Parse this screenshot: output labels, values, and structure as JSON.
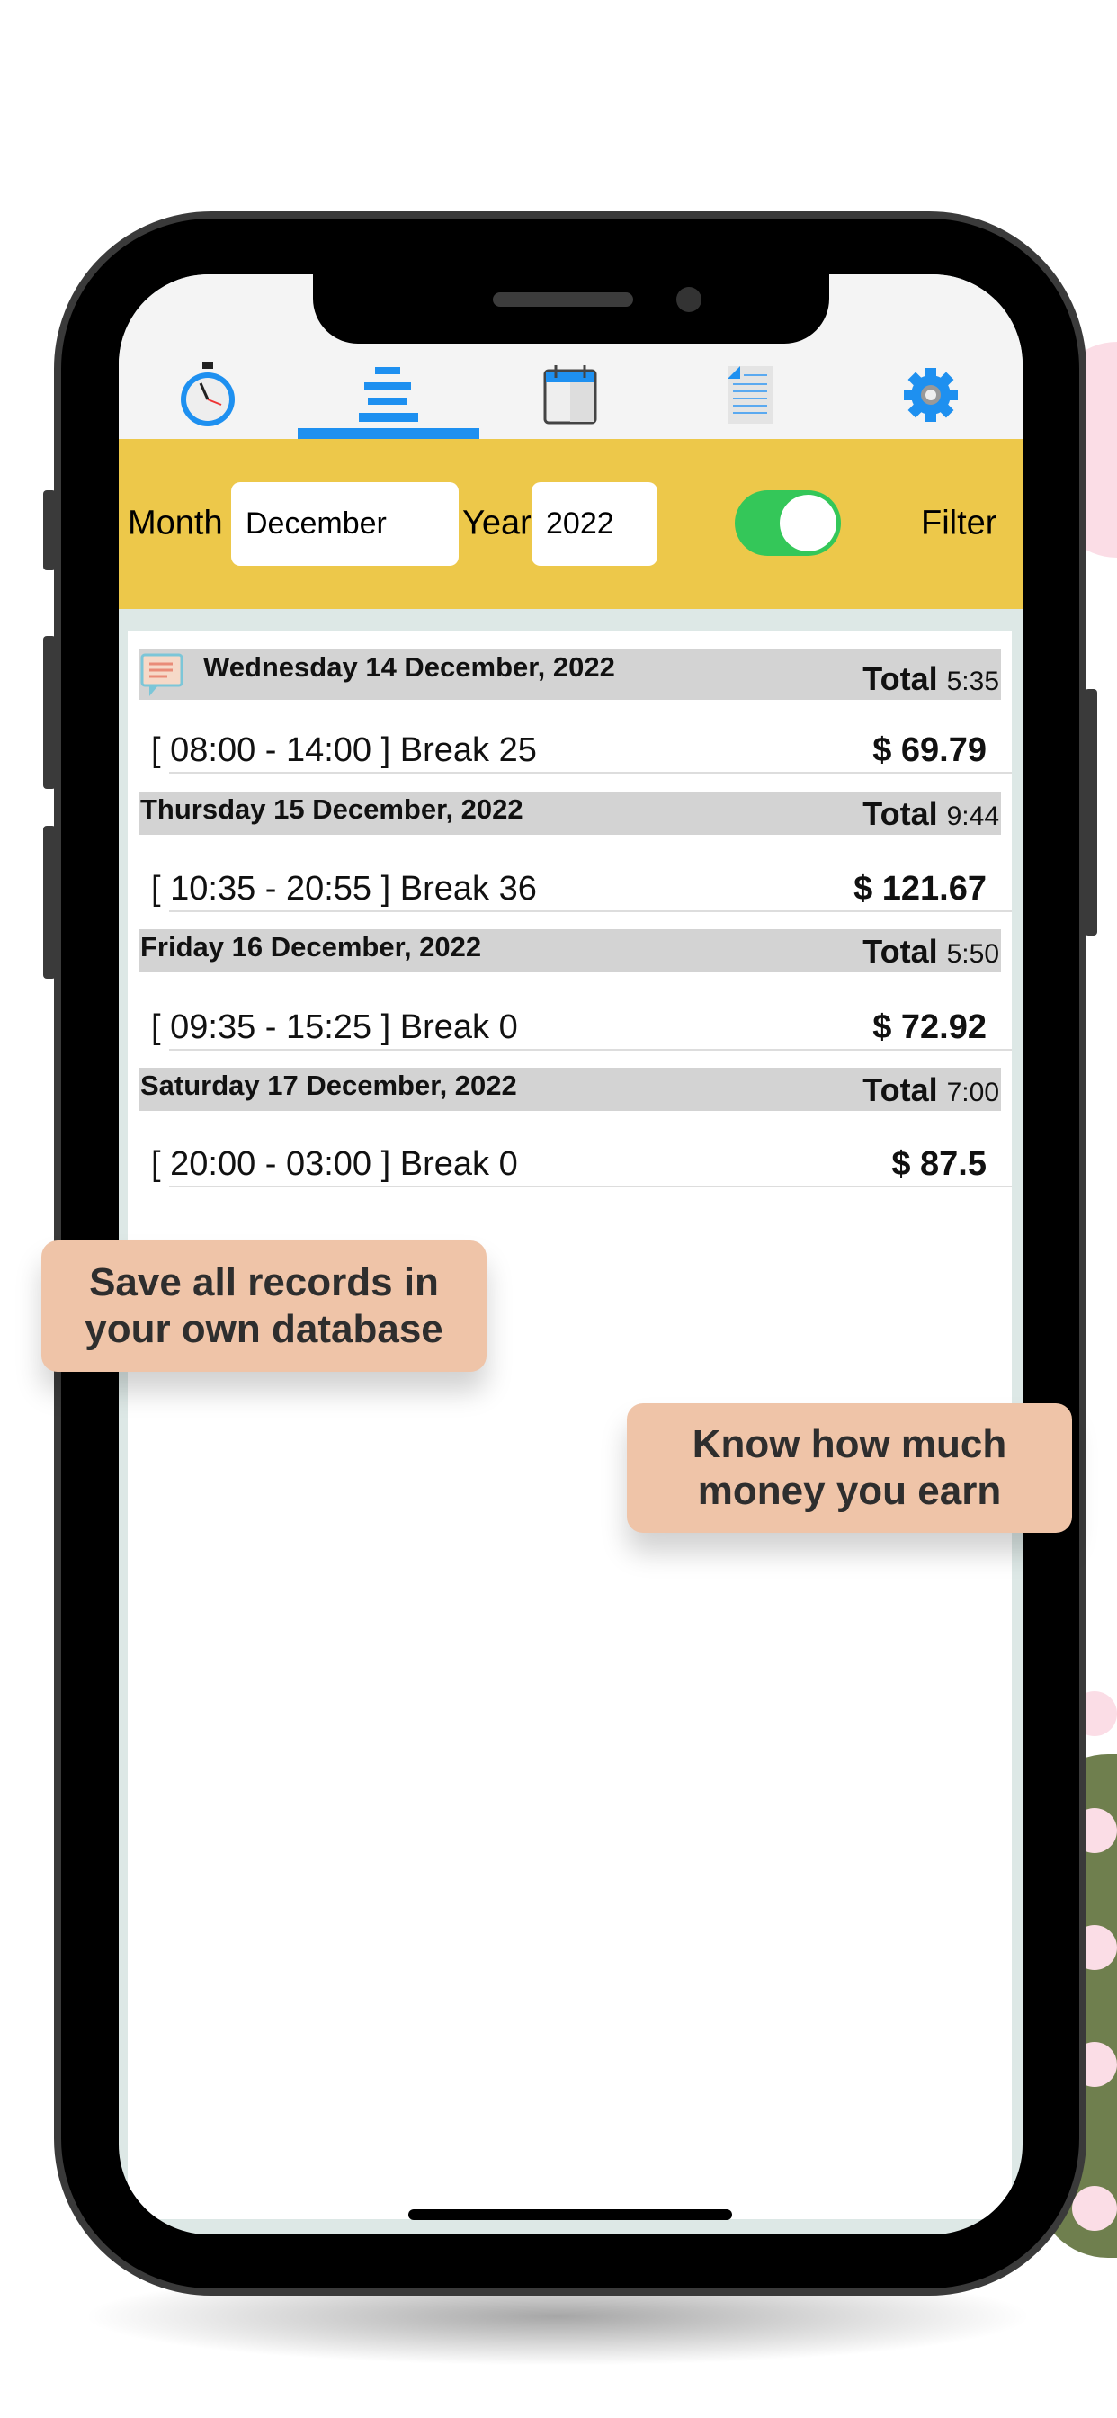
{
  "tabs": [
    {
      "icon": "stopwatch-icon"
    },
    {
      "icon": "list-icon",
      "active": true
    },
    {
      "icon": "calendar-icon"
    },
    {
      "icon": "document-icon"
    },
    {
      "icon": "gear-icon"
    }
  ],
  "filter": {
    "month_label": "Month",
    "month_value": "December",
    "year_label": "Year",
    "year_value": "2022",
    "toggle_on": true,
    "filter_label": "Filter"
  },
  "records": [
    {
      "date": "Wednesday 14 December, 2022",
      "total_label": "Total",
      "total": "5:35",
      "has_note": true,
      "times": "[ 08:00 - 14:00 ] Break 25",
      "amount": "$ 69.79"
    },
    {
      "date": "Thursday 15 December, 2022",
      "total_label": "Total",
      "total": "9:44",
      "times": "[ 10:35 - 20:55 ] Break 36",
      "amount": "$ 121.67"
    },
    {
      "date": "Friday 16 December, 2022",
      "total_label": "Total",
      "total": "5:50",
      "times": "[ 09:35 - 15:25 ] Break 0",
      "amount": "$ 72.92"
    },
    {
      "date": "Saturday 17 December, 2022",
      "total_label": "Total",
      "total": "7:00",
      "times": "[ 20:00 - 03:00 ] Break 0",
      "amount": "$ 87.5"
    }
  ],
  "callouts": {
    "left": "Save all records in your own database",
    "right": "Know how much money you earn"
  },
  "colors": {
    "accent": "#1e90f0",
    "filter_bar": "#edc84a",
    "toggle": "#34c759",
    "callout": "#efc4a8"
  }
}
